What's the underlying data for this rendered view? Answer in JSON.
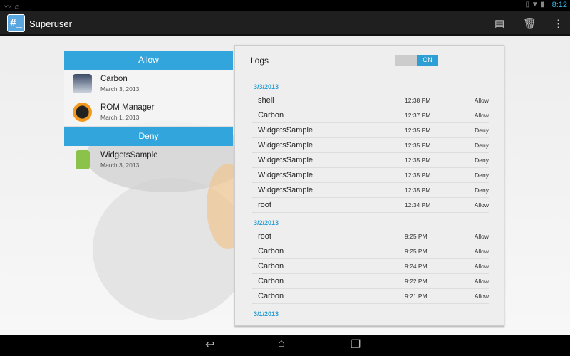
{
  "status_bar": {
    "time": "8:12"
  },
  "action_bar": {
    "logo_text": "#_",
    "title": "Superuser",
    "icons": [
      "log-icon",
      "delete-icon",
      "overflow-menu-icon"
    ]
  },
  "apps": {
    "allow_header": "Allow",
    "deny_header": "Deny",
    "allow": [
      {
        "name": "Carbon",
        "date": "March 3, 2013"
      },
      {
        "name": "ROM Manager",
        "date": "March 1, 2013"
      }
    ],
    "deny": [
      {
        "name": "WidgetsSample",
        "date": "March 3, 2013"
      }
    ]
  },
  "logs": {
    "label": "Logs",
    "toggle": "ON",
    "sections": [
      {
        "date": "3/3/2013",
        "rows": [
          {
            "app": "shell",
            "time": "12:38 PM",
            "status": "Allow"
          },
          {
            "app": "Carbon",
            "time": "12:37 PM",
            "status": "Allow"
          },
          {
            "app": "WidgetsSample",
            "time": "12:35 PM",
            "status": "Deny"
          },
          {
            "app": "WidgetsSample",
            "time": "12:35 PM",
            "status": "Deny"
          },
          {
            "app": "WidgetsSample",
            "time": "12:35 PM",
            "status": "Deny"
          },
          {
            "app": "WidgetsSample",
            "time": "12:35 PM",
            "status": "Deny"
          },
          {
            "app": "WidgetsSample",
            "time": "12:35 PM",
            "status": "Deny"
          },
          {
            "app": "root",
            "time": "12:34 PM",
            "status": "Allow"
          }
        ]
      },
      {
        "date": "3/2/2013",
        "rows": [
          {
            "app": "root",
            "time": "9:25 PM",
            "status": "Allow"
          },
          {
            "app": "Carbon",
            "time": "9:25 PM",
            "status": "Allow"
          },
          {
            "app": "Carbon",
            "time": "9:24 PM",
            "status": "Allow"
          },
          {
            "app": "Carbon",
            "time": "9:22 PM",
            "status": "Allow"
          },
          {
            "app": "Carbon",
            "time": "9:21 PM",
            "status": "Allow"
          }
        ]
      },
      {
        "date": "3/1/2013",
        "rows": []
      }
    ]
  }
}
